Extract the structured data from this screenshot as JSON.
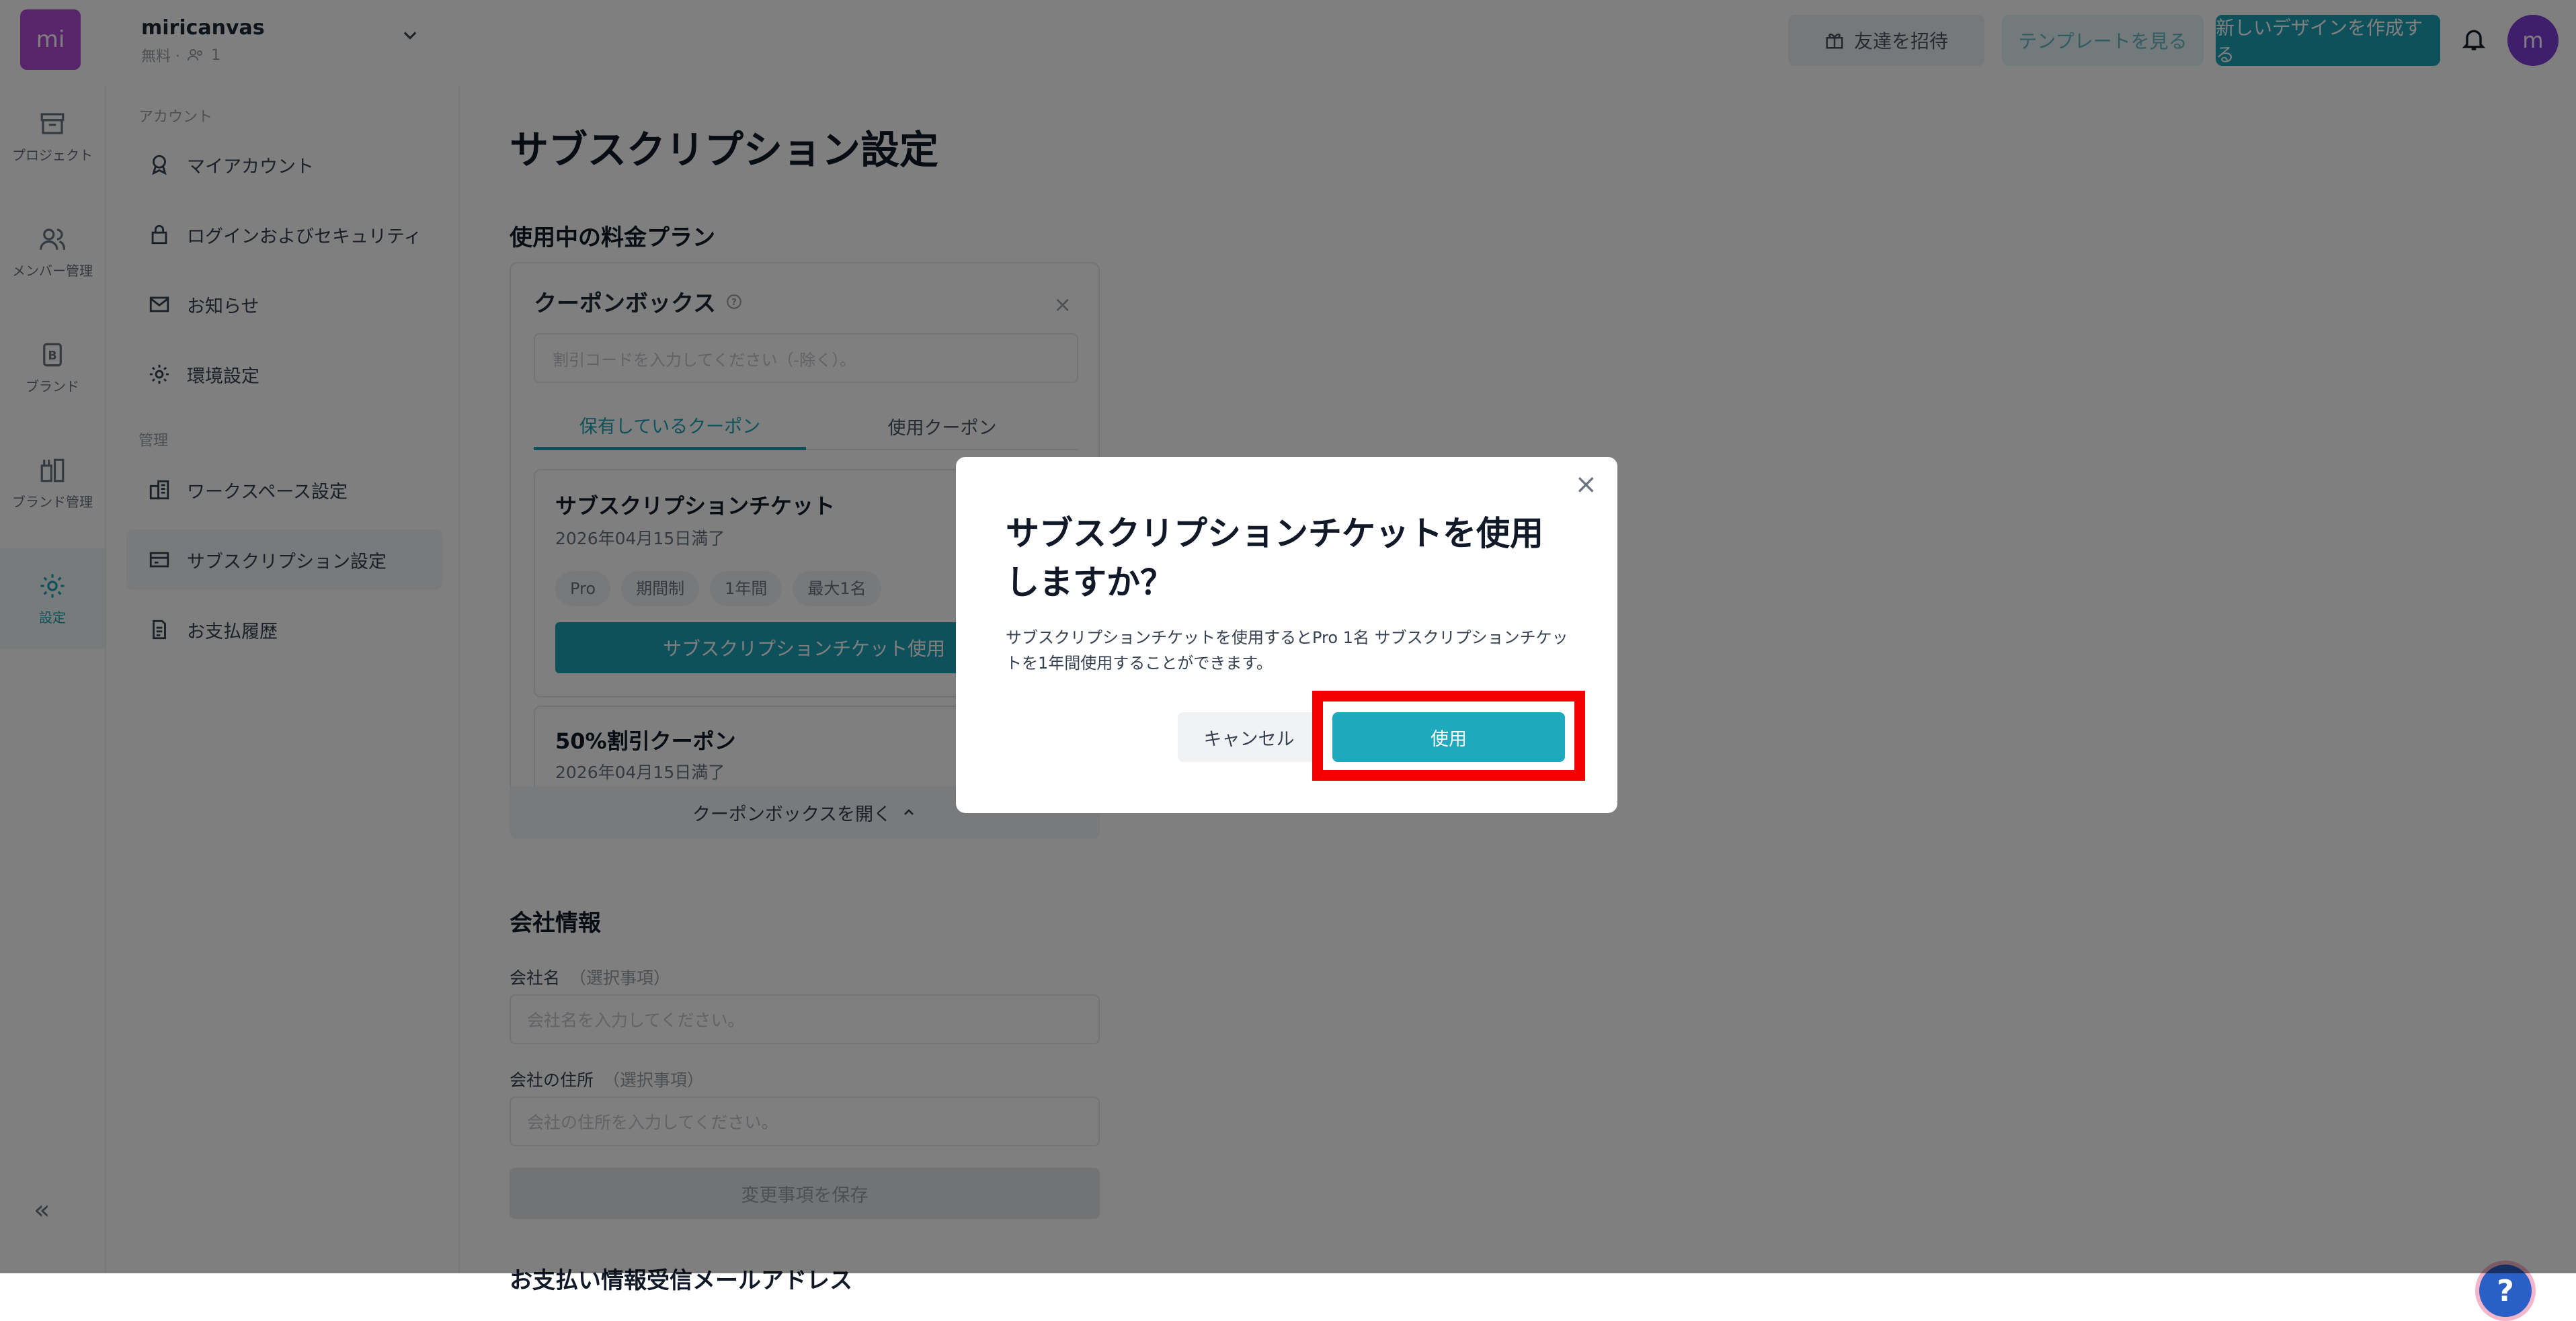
{
  "topbar": {
    "logo_text": "mi",
    "workspace_name": "miricanvas",
    "workspace_plan": "無料 ·",
    "member_count": "1",
    "invite_label": "友達を招待",
    "templates_label": "テンプレートを見る",
    "new_design_label": "新しいデザインを作成する",
    "avatar_letter": "m"
  },
  "rail": {
    "projects": "プロジェクト",
    "members": "メンバー管理",
    "brand": "ブランド",
    "brand_manage": "ブランド管理",
    "settings": "設定",
    "collapse": "«"
  },
  "settings_nav": {
    "account_section": "アカウント",
    "my_account": "マイアカウント",
    "login_security": "ログインおよびセキュリティ",
    "notifications": "お知らせ",
    "preferences": "環境設定",
    "manage_section": "管理",
    "workspace_settings": "ワークスペース設定",
    "subscription_settings": "サブスクリプション設定",
    "payment_history": "お支払履歴"
  },
  "main": {
    "page_title": "サブスクリプション設定",
    "current_plan_title": "使用中の料金プラン",
    "coupon_box": {
      "title": "クーポンボックス",
      "close": "×",
      "input_placeholder": "割引コードを入力してください（-除く）。",
      "tab_owned": "保有しているクーポン",
      "tab_used": "使用クーポン",
      "coupons": [
        {
          "title": "サブスクリプションチケット",
          "expiry": "2026年04月15日満了",
          "tags": [
            "Pro",
            "期間制",
            "1年間",
            "最大1名"
          ],
          "button": "サブスクリプションチケット使用"
        },
        {
          "title": "50%割引クーポン",
          "expiry": "2026年04月15日満了"
        }
      ],
      "open_label": "クーポンボックスを開く"
    },
    "company_title": "会社情報",
    "company_name_label": "会社名",
    "optional": "（選択事項）",
    "company_name_placeholder": "会社名を入力してください。",
    "company_address_label": "会社の住所",
    "company_address_placeholder": "会社の住所を入力してください。",
    "save_label": "変更事項を保存",
    "cut_title": "お支払い情報受信メールアドレス"
  },
  "help": "?",
  "modal": {
    "close": "×",
    "title": "サブスクリプションチケットを使用しますか？",
    "body": "サブスクリプションチケットを使用するとPro 1名 サブスクリプションチケットを1年間使用することができます。",
    "cancel": "キャンセル",
    "confirm": "使用",
    "highlight_color": "#f40000"
  }
}
